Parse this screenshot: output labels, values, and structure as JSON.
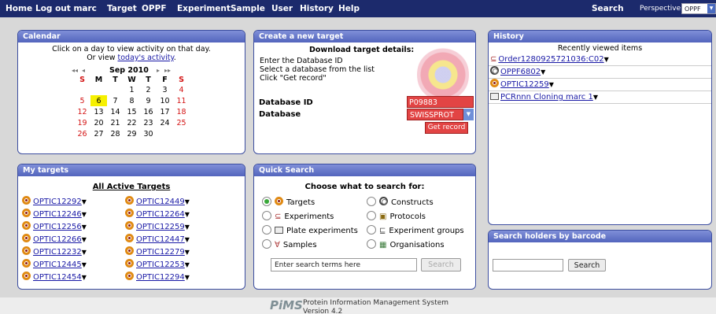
{
  "nav": {
    "home": "Home",
    "logout": "Log out marc",
    "target": "Target",
    "oppf": "OPPF",
    "experiment": "Experiment",
    "sample": "Sample",
    "user": "User",
    "history": "History",
    "help": "Help",
    "search": "Search",
    "perspective_label": "Perspective:",
    "perspective_value": "OPPF"
  },
  "calendar": {
    "title": "Calendar",
    "intro_line1": "Click on a day to view activity on that day.",
    "intro_line2_prefix": "Or view ",
    "intro_link": "today's activity",
    "intro_line2_suffix": ".",
    "prev_year": "◂◂",
    "prev_month": "◂",
    "month": "Sep 2010",
    "next_month": "▸",
    "next_year": "▸▸",
    "weekdays": [
      "S",
      "M",
      "T",
      "W",
      "T",
      "F",
      "S"
    ],
    "weeks": [
      [
        "",
        "",
        "",
        "1",
        "2",
        "3",
        "4"
      ],
      [
        "5",
        "6",
        "7",
        "8",
        "9",
        "10",
        "11"
      ],
      [
        "12",
        "13",
        "14",
        "15",
        "16",
        "17",
        "18"
      ],
      [
        "19",
        "20",
        "21",
        "22",
        "23",
        "24",
        "25"
      ],
      [
        "26",
        "27",
        "28",
        "29",
        "30",
        "",
        ""
      ]
    ],
    "today": "6"
  },
  "create_target": {
    "title": "Create a new target",
    "heading": "Download target details:",
    "line1": "Enter the Database ID",
    "line2": "Select a database from the list",
    "line3": "Click \"Get record\"",
    "db_id_label": "Database ID",
    "db_id_value": "P09883",
    "db_label": "Database",
    "db_value": "SWISSPROT",
    "get_record": "Get record"
  },
  "history": {
    "title": "History",
    "subtitle": "Recently viewed items",
    "items": [
      {
        "label": "Order1280925721036:C02",
        "icon": "experiment-icon"
      },
      {
        "label": "OPPF6802",
        "icon": "construct-icon"
      },
      {
        "label": "OPTIC12259",
        "icon": "target-icon"
      },
      {
        "label": "PCRnnn Cloning marc 1",
        "icon": "plate-experiment-icon"
      }
    ]
  },
  "my_targets": {
    "title": "My targets",
    "heading": "All Active Targets",
    "col1": [
      "OPTIC12292",
      "OPTIC12246",
      "OPTIC12256",
      "OPTIC12266",
      "OPTIC12232",
      "OPTIC12445",
      "OPTIC12454"
    ],
    "col2": [
      "OPTIC12449",
      "OPTIC12264",
      "OPTIC12259",
      "OPTIC12447",
      "OPTIC12279",
      "OPTIC12253",
      "OPTIC12294"
    ]
  },
  "quick_search": {
    "title": "Quick Search",
    "heading": "Choose what to search for:",
    "options_left": [
      "Targets",
      "Experiments",
      "Plate experiments",
      "Samples"
    ],
    "options_right": [
      "Constructs",
      "Protocols",
      "Experiment groups",
      "Organisations"
    ],
    "selected": "Targets",
    "placeholder": "Enter search terms here",
    "search_button": "Search"
  },
  "barcode": {
    "title": "Search holders by barcode",
    "search_button": "Search"
  },
  "footer": {
    "logo": "PiMS",
    "line1": "Protein Information Management System",
    "line2": "Version 4.2"
  },
  "colors": {
    "nav_bg": "#1c2a6c",
    "panel_head": "#5365bd",
    "highlight_red": "#e24444",
    "today_yellow": "#f6f000"
  }
}
